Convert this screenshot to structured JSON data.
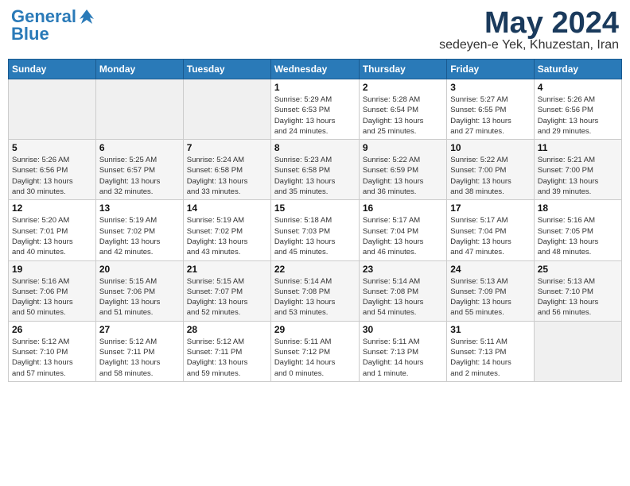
{
  "logo": {
    "line1": "General",
    "line2": "Blue"
  },
  "title": "May 2024",
  "subtitle": "sedeyen-e Yek, Khuzestan, Iran",
  "weekdays": [
    "Sunday",
    "Monday",
    "Tuesday",
    "Wednesday",
    "Thursday",
    "Friday",
    "Saturday"
  ],
  "weeks": [
    [
      {
        "day": "",
        "info": ""
      },
      {
        "day": "",
        "info": ""
      },
      {
        "day": "",
        "info": ""
      },
      {
        "day": "1",
        "info": "Sunrise: 5:29 AM\nSunset: 6:53 PM\nDaylight: 13 hours\nand 24 minutes."
      },
      {
        "day": "2",
        "info": "Sunrise: 5:28 AM\nSunset: 6:54 PM\nDaylight: 13 hours\nand 25 minutes."
      },
      {
        "day": "3",
        "info": "Sunrise: 5:27 AM\nSunset: 6:55 PM\nDaylight: 13 hours\nand 27 minutes."
      },
      {
        "day": "4",
        "info": "Sunrise: 5:26 AM\nSunset: 6:56 PM\nDaylight: 13 hours\nand 29 minutes."
      }
    ],
    [
      {
        "day": "5",
        "info": "Sunrise: 5:26 AM\nSunset: 6:56 PM\nDaylight: 13 hours\nand 30 minutes."
      },
      {
        "day": "6",
        "info": "Sunrise: 5:25 AM\nSunset: 6:57 PM\nDaylight: 13 hours\nand 32 minutes."
      },
      {
        "day": "7",
        "info": "Sunrise: 5:24 AM\nSunset: 6:58 PM\nDaylight: 13 hours\nand 33 minutes."
      },
      {
        "day": "8",
        "info": "Sunrise: 5:23 AM\nSunset: 6:58 PM\nDaylight: 13 hours\nand 35 minutes."
      },
      {
        "day": "9",
        "info": "Sunrise: 5:22 AM\nSunset: 6:59 PM\nDaylight: 13 hours\nand 36 minutes."
      },
      {
        "day": "10",
        "info": "Sunrise: 5:22 AM\nSunset: 7:00 PM\nDaylight: 13 hours\nand 38 minutes."
      },
      {
        "day": "11",
        "info": "Sunrise: 5:21 AM\nSunset: 7:00 PM\nDaylight: 13 hours\nand 39 minutes."
      }
    ],
    [
      {
        "day": "12",
        "info": "Sunrise: 5:20 AM\nSunset: 7:01 PM\nDaylight: 13 hours\nand 40 minutes."
      },
      {
        "day": "13",
        "info": "Sunrise: 5:19 AM\nSunset: 7:02 PM\nDaylight: 13 hours\nand 42 minutes."
      },
      {
        "day": "14",
        "info": "Sunrise: 5:19 AM\nSunset: 7:02 PM\nDaylight: 13 hours\nand 43 minutes."
      },
      {
        "day": "15",
        "info": "Sunrise: 5:18 AM\nSunset: 7:03 PM\nDaylight: 13 hours\nand 45 minutes."
      },
      {
        "day": "16",
        "info": "Sunrise: 5:17 AM\nSunset: 7:04 PM\nDaylight: 13 hours\nand 46 minutes."
      },
      {
        "day": "17",
        "info": "Sunrise: 5:17 AM\nSunset: 7:04 PM\nDaylight: 13 hours\nand 47 minutes."
      },
      {
        "day": "18",
        "info": "Sunrise: 5:16 AM\nSunset: 7:05 PM\nDaylight: 13 hours\nand 48 minutes."
      }
    ],
    [
      {
        "day": "19",
        "info": "Sunrise: 5:16 AM\nSunset: 7:06 PM\nDaylight: 13 hours\nand 50 minutes."
      },
      {
        "day": "20",
        "info": "Sunrise: 5:15 AM\nSunset: 7:06 PM\nDaylight: 13 hours\nand 51 minutes."
      },
      {
        "day": "21",
        "info": "Sunrise: 5:15 AM\nSunset: 7:07 PM\nDaylight: 13 hours\nand 52 minutes."
      },
      {
        "day": "22",
        "info": "Sunrise: 5:14 AM\nSunset: 7:08 PM\nDaylight: 13 hours\nand 53 minutes."
      },
      {
        "day": "23",
        "info": "Sunrise: 5:14 AM\nSunset: 7:08 PM\nDaylight: 13 hours\nand 54 minutes."
      },
      {
        "day": "24",
        "info": "Sunrise: 5:13 AM\nSunset: 7:09 PM\nDaylight: 13 hours\nand 55 minutes."
      },
      {
        "day": "25",
        "info": "Sunrise: 5:13 AM\nSunset: 7:10 PM\nDaylight: 13 hours\nand 56 minutes."
      }
    ],
    [
      {
        "day": "26",
        "info": "Sunrise: 5:12 AM\nSunset: 7:10 PM\nDaylight: 13 hours\nand 57 minutes."
      },
      {
        "day": "27",
        "info": "Sunrise: 5:12 AM\nSunset: 7:11 PM\nDaylight: 13 hours\nand 58 minutes."
      },
      {
        "day": "28",
        "info": "Sunrise: 5:12 AM\nSunset: 7:11 PM\nDaylight: 13 hours\nand 59 minutes."
      },
      {
        "day": "29",
        "info": "Sunrise: 5:11 AM\nSunset: 7:12 PM\nDaylight: 14 hours\nand 0 minutes."
      },
      {
        "day": "30",
        "info": "Sunrise: 5:11 AM\nSunset: 7:13 PM\nDaylight: 14 hours\nand 1 minute."
      },
      {
        "day": "31",
        "info": "Sunrise: 5:11 AM\nSunset: 7:13 PM\nDaylight: 14 hours\nand 2 minutes."
      },
      {
        "day": "",
        "info": ""
      }
    ]
  ]
}
